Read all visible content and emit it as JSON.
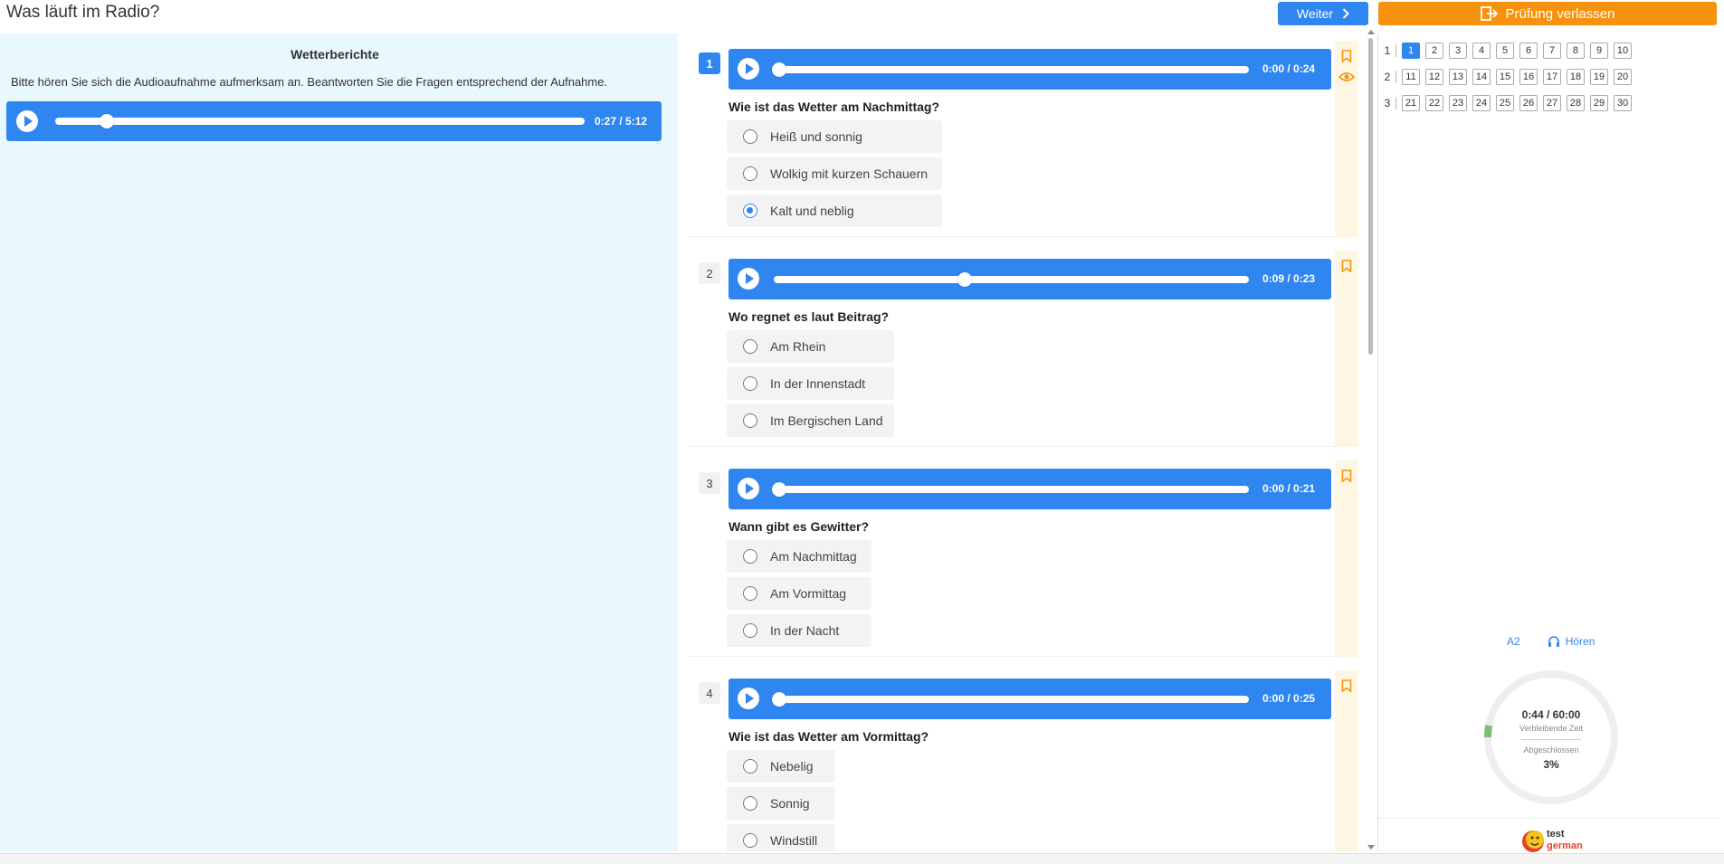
{
  "header": {
    "title": "Was läuft im Radio?",
    "next_label": "Weiter",
    "exit_label": "Prüfung verlassen"
  },
  "left": {
    "heading": "Wetterberichte",
    "instruction": "Bitte hören Sie sich die Audioaufnahme aufmerksam an. Beantworten Sie die Fragen entsprechend der Aufnahme.",
    "player": {
      "time": "0:27 / 5:12",
      "progress": 0.087
    }
  },
  "questions": [
    {
      "number": "1",
      "active": true,
      "time": "0:00 / 0:24",
      "progress": 0,
      "text": "Wie ist das Wetter am Nachmittag?",
      "options": [
        "Heiß und sonnig",
        "Wolkig mit kurzen Schauern",
        "Kalt und neblig"
      ],
      "selected": 2,
      "has_eye": true
    },
    {
      "number": "2",
      "active": false,
      "time": "0:09 / 0:23",
      "progress": 0.39,
      "text": "Wo regnet es laut Beitrag?",
      "options": [
        "Am Rhein",
        "In der Innenstadt",
        "Im Bergischen Land"
      ],
      "selected": -1,
      "has_eye": false
    },
    {
      "number": "3",
      "active": false,
      "time": "0:00 / 0:21",
      "progress": 0,
      "text": "Wann gibt es Gewitter?",
      "options": [
        "Am Nachmittag",
        "Am Vormittag",
        "In der Nacht"
      ],
      "selected": -1,
      "has_eye": false
    },
    {
      "number": "4",
      "active": false,
      "time": "0:00 / 0:25",
      "progress": 0,
      "text": "Wie ist das Wetter am Vormittag?",
      "options": [
        "Nebelig",
        "Sonnig",
        "Windstill"
      ],
      "selected": -1,
      "has_eye": false
    }
  ],
  "nav": {
    "rows": [
      {
        "label": "1",
        "items": [
          "1",
          "2",
          "3",
          "4",
          "5",
          "6",
          "7",
          "8",
          "9",
          "10"
        ]
      },
      {
        "label": "2",
        "items": [
          "11",
          "12",
          "13",
          "14",
          "15",
          "16",
          "17",
          "18",
          "19",
          "20"
        ]
      },
      {
        "label": "3",
        "items": [
          "21",
          "22",
          "23",
          "24",
          "25",
          "26",
          "27",
          "28",
          "29",
          "30"
        ]
      }
    ],
    "current": "1"
  },
  "status": {
    "level": "A2",
    "skill": "Hören",
    "timer": "0:44 / 60:00",
    "timer_label": "Verbleibende Zeit",
    "done_label": "Abgeschlossen",
    "done_pct": "3%",
    "done_fraction": 0.03,
    "logo_top": "test",
    "logo_bottom": "german"
  },
  "colors": {
    "primary": "#2f86f0",
    "accent": "#f7920f",
    "panel_bg": "#e9f8fe"
  }
}
